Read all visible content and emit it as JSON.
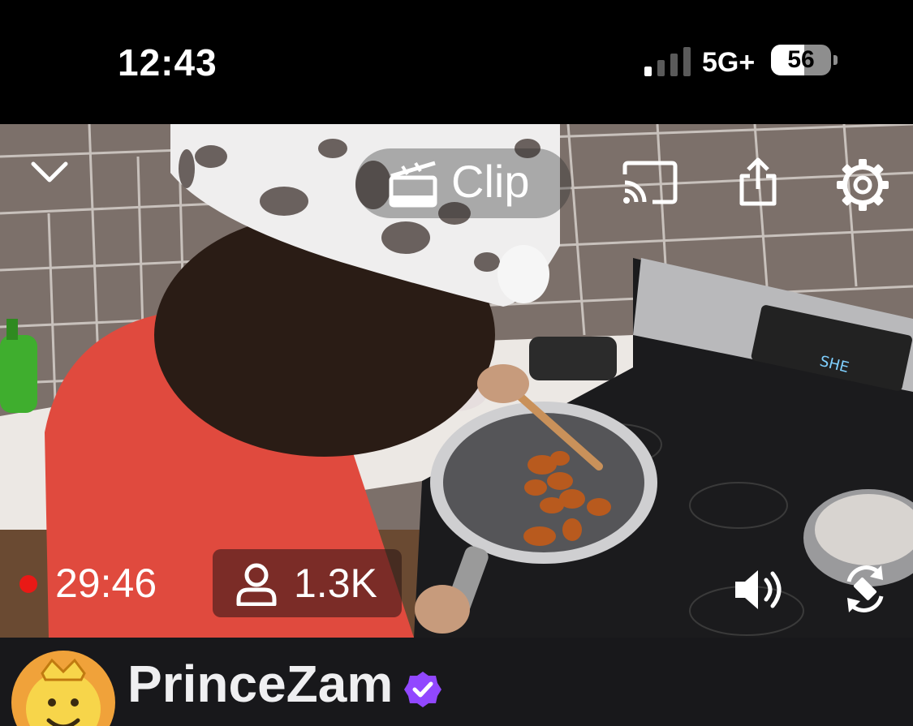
{
  "status_bar": {
    "time": "12:43",
    "network": "5G+",
    "battery_level": "56",
    "battery_fraction": 0.56
  },
  "player": {
    "clip_label": "Clip",
    "uptime": "29:46",
    "viewer_count": "1.3K",
    "live_color": "#e91916",
    "icons": [
      "chevron-down-icon",
      "clip-icon",
      "cast-icon",
      "share-icon",
      "settings-icon",
      "person-icon",
      "volume-icon",
      "rotate-icon"
    ]
  },
  "channel": {
    "name": "PrinceZam",
    "verified_color": "#9147ff"
  }
}
